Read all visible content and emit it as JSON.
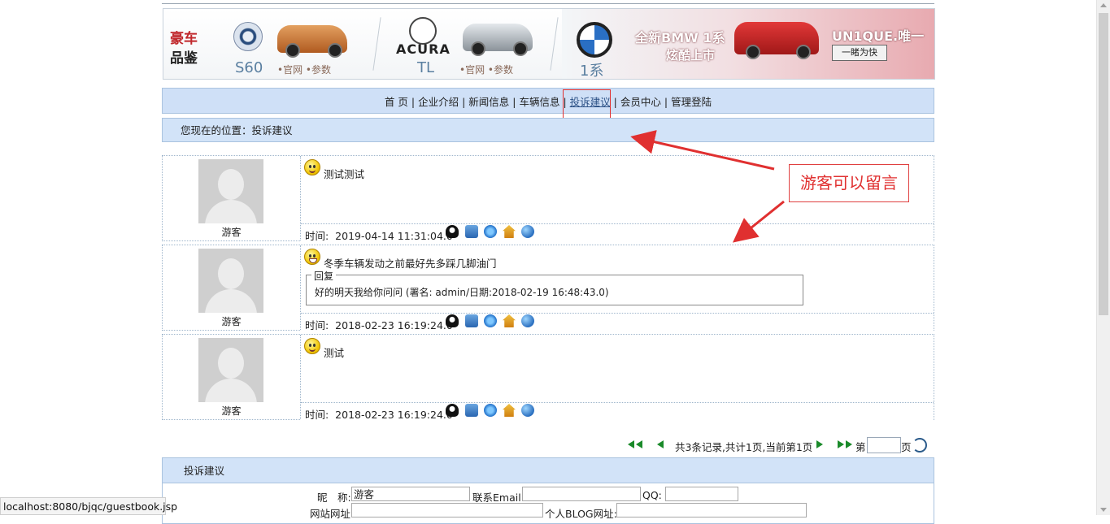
{
  "banner": {
    "haoche": "豪车",
    "pinjian": "品鉴",
    "volvo_model": "S60",
    "volvo_links": "•官网 •参数",
    "acura_name": "ACURA",
    "acura_model": "TL",
    "acura_links": "•官网 •参数",
    "bmw_model": "1系",
    "bmw_headline": "全新BMW 1系",
    "bmw_subline": "炫酷上市",
    "bmw_slogan": "UN1QUE.唯一",
    "bmw_button": "一睹为快"
  },
  "nav": {
    "items": [
      {
        "label": "首 页"
      },
      {
        "label": "企业介绍"
      },
      {
        "label": "新闻信息"
      },
      {
        "label": "车辆信息"
      },
      {
        "label": "投诉建议"
      },
      {
        "label": "会员中心"
      },
      {
        "label": "管理登陆"
      }
    ],
    "separator": "|"
  },
  "location": {
    "prefix": "您现在的位置：",
    "current": "投诉建议"
  },
  "annotation": {
    "text": "游客可以留言",
    "color": "#e03030"
  },
  "entries": [
    {
      "user": "游客",
      "content": "测试测试",
      "time_label": "时间:",
      "time": "2019-04-14 11:31:04.0",
      "face": "smile-face"
    },
    {
      "user": "游客",
      "content": "冬季车辆发动之前最好先多踩几脚油门",
      "reply_legend": "回复",
      "reply": "好的明天我给你问问 (署名: admin/日期:2018-02-19 16:48:43.0)",
      "time_label": "时间:",
      "time": "2018-02-23 16:19:24.0",
      "face": "grin-face"
    },
    {
      "user": "游客",
      "content": "测试",
      "time_label": "时间:",
      "time": "2018-02-23 16:19:24.0",
      "face": "smile-face"
    }
  ],
  "pager": {
    "info": "共3条记录,共计1页,当前第1页",
    "page_prefix": "第",
    "page_suffix": "页"
  },
  "form": {
    "title": "投诉建议",
    "nickname_label": "昵　称:",
    "nickname_value": "游客",
    "email_label": "联系Email:",
    "email_value": "",
    "qq_label": "QQ:",
    "qq_value": "",
    "website_label": "网站网址:",
    "website_value": "",
    "blog_label": "个人BLOG网址:",
    "blog_value": ""
  },
  "status_bar": {
    "url": "localhost:8080/bjqc/guestbook.jsp"
  },
  "colors": {
    "nav_bg": "#cfe0f7",
    "highlight_red": "#e03030",
    "border_blue": "#aac3df"
  }
}
